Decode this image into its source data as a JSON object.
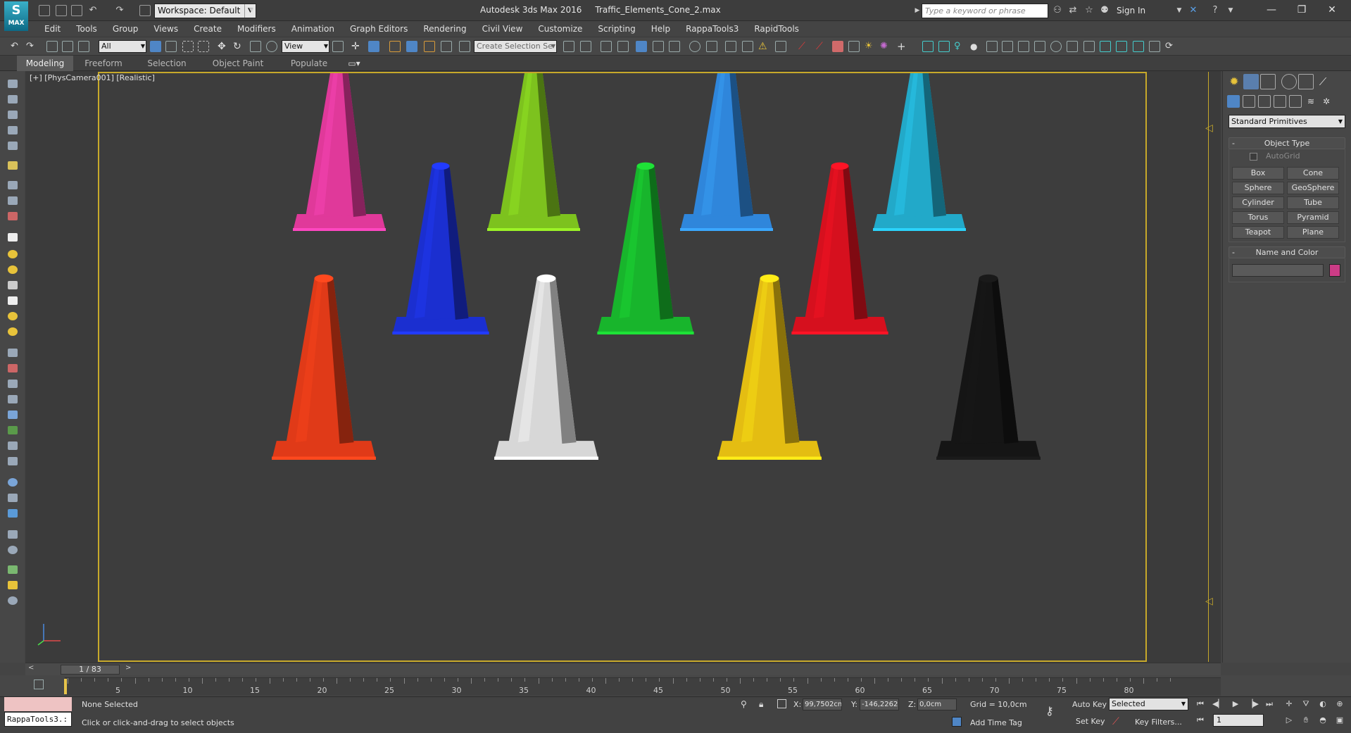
{
  "app": {
    "title": "Autodesk 3ds Max 2016     Traffic_Elements_Cone_2.max",
    "logo_text": "MAX",
    "workspace": "Workspace: Default",
    "search_placeholder": "Type a keyword or phrase",
    "sign_in": "Sign In"
  },
  "menu": [
    "Edit",
    "Tools",
    "Group",
    "Views",
    "Create",
    "Modifiers",
    "Animation",
    "Graph Editors",
    "Rendering",
    "Civil View",
    "Customize",
    "Scripting",
    "Help",
    "RappaTools3",
    "RapidTools"
  ],
  "toolbar": {
    "filter_value": "All",
    "refcoord_value": "View",
    "selection_set_placeholder": "Create Selection Se"
  },
  "ribbon_tabs": [
    "Modeling",
    "Freeform",
    "Selection",
    "Object Paint",
    "Populate"
  ],
  "viewport": {
    "label": "[+] [PhysCamera001] [Realistic]",
    "cones": [
      {
        "color": "#e0399a"
      },
      {
        "color": "#7dc21e"
      },
      {
        "color": "#2f86db"
      },
      {
        "color": "#22a9c9"
      },
      {
        "color": "#1b2fd0"
      },
      {
        "color": "#18b52c"
      },
      {
        "color": "#d6101e"
      },
      {
        "color": "#e03a18"
      },
      {
        "color": "#d7d7d7"
      },
      {
        "color": "#e4bd12"
      },
      {
        "color": "#151515"
      }
    ]
  },
  "command_panel": {
    "category": "Standard Primitives",
    "object_type_title": "Object Type",
    "autogrid": "AutoGrid",
    "primitives": [
      "Box",
      "Cone",
      "Sphere",
      "GeoSphere",
      "Cylinder",
      "Tube",
      "Torus",
      "Pyramid",
      "Teapot",
      "Plane"
    ],
    "name_color_title": "Name and Color",
    "swatch_color": "#cc3c86"
  },
  "timeline": {
    "slider": "1 / 83",
    "ticks": [
      "5",
      "10",
      "15",
      "20",
      "25",
      "30",
      "35",
      "40",
      "45",
      "50",
      "55",
      "60",
      "65",
      "70",
      "75",
      "80"
    ]
  },
  "status": {
    "listener_text": "RappaTools3.:",
    "selection": "None Selected",
    "prompt": "Click or click-and-drag to select objects",
    "x_label": "X:",
    "x_value": "99,7502cm",
    "y_label": "Y:",
    "y_value": "-146,2262c",
    "z_label": "Z:",
    "z_value": "0,0cm",
    "grid": "Grid = 10,0cm",
    "add_time_tag": "Add Time Tag",
    "auto_key": "Auto Key",
    "set_key": "Set Key",
    "key_mode": "Selected",
    "key_filters": "Key Filters...",
    "frame": "1"
  }
}
